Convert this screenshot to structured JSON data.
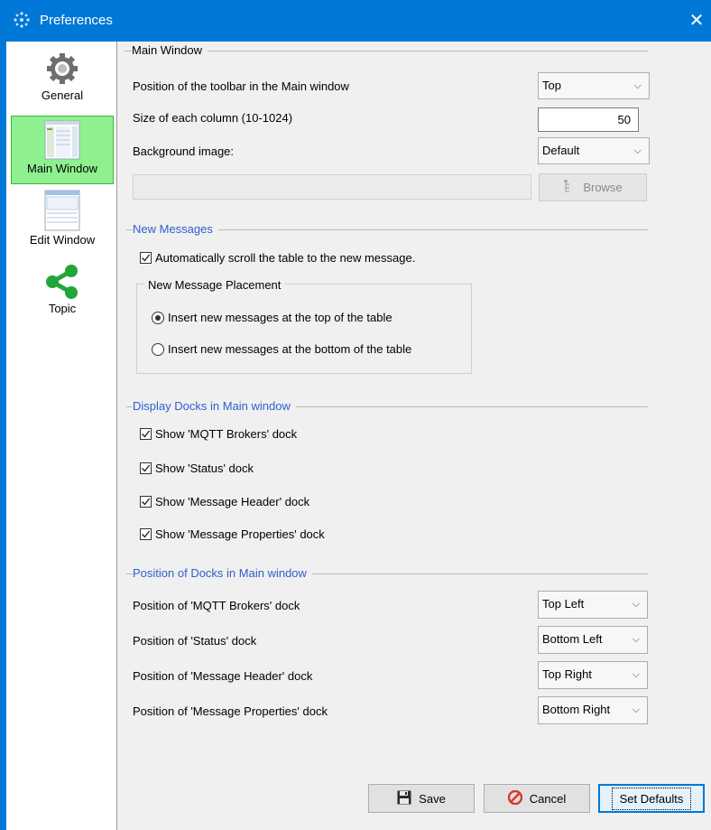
{
  "window": {
    "title": "Preferences",
    "close_glyph": "✕"
  },
  "sidebar": {
    "items": [
      {
        "label": "General",
        "icon": "gear-icon",
        "selected": false
      },
      {
        "label": "Main Window",
        "icon": "main-window-thumbnail-icon",
        "selected": true
      },
      {
        "label": "Edit Window",
        "icon": "edit-window-thumbnail-icon",
        "selected": false
      },
      {
        "label": "Topic",
        "icon": "topic-share-icon",
        "selected": false
      }
    ]
  },
  "main_window_group": {
    "title": "Main Window",
    "toolbar_position_label": "Position of the toolbar in the Main window",
    "toolbar_position_value": "Top",
    "column_size_label": "Size of each column (10-1024)",
    "column_size_value": "50",
    "background_label": "Background image:",
    "background_value": "Default",
    "background_path": "",
    "browse_label": "Browse"
  },
  "new_messages_group": {
    "title": "New Messages",
    "autoscroll_label": "Automatically scroll the table to the new message.",
    "autoscroll_checked": true,
    "placement_title": "New Message Placement",
    "placement_top_label": "Insert new messages at the top of the table",
    "placement_bottom_label": "Insert new messages at the bottom of the table",
    "placement_selected": "top"
  },
  "display_docks_group": {
    "title": "Display Docks in Main window",
    "items": [
      {
        "label": "Show 'MQTT Brokers' dock",
        "checked": true
      },
      {
        "label": "Show 'Status' dock",
        "checked": true
      },
      {
        "label": "Show 'Message Header' dock",
        "checked": true
      },
      {
        "label": "Show 'Message Properties' dock",
        "checked": true
      }
    ]
  },
  "dock_positions_group": {
    "title": "Position of Docks in Main window",
    "items": [
      {
        "label": "Position of 'MQTT Brokers' dock",
        "value": "Top Left"
      },
      {
        "label": "Position of 'Status' dock",
        "value": "Bottom Left"
      },
      {
        "label": "Position of 'Message Header' dock",
        "value": "Top Right"
      },
      {
        "label": "Position of 'Message Properties' dock",
        "value": "Bottom Right"
      }
    ]
  },
  "footer": {
    "save_label": "Save",
    "cancel_label": "Cancel",
    "defaults_label": "Set Defaults"
  },
  "colors": {
    "titlebar": "#0078d7",
    "selected_nav": "#8ef08e",
    "group_title_blue": "#2f5fcc",
    "cancel_icon": "#d9342b"
  },
  "chevron_glyph": "⌵"
}
